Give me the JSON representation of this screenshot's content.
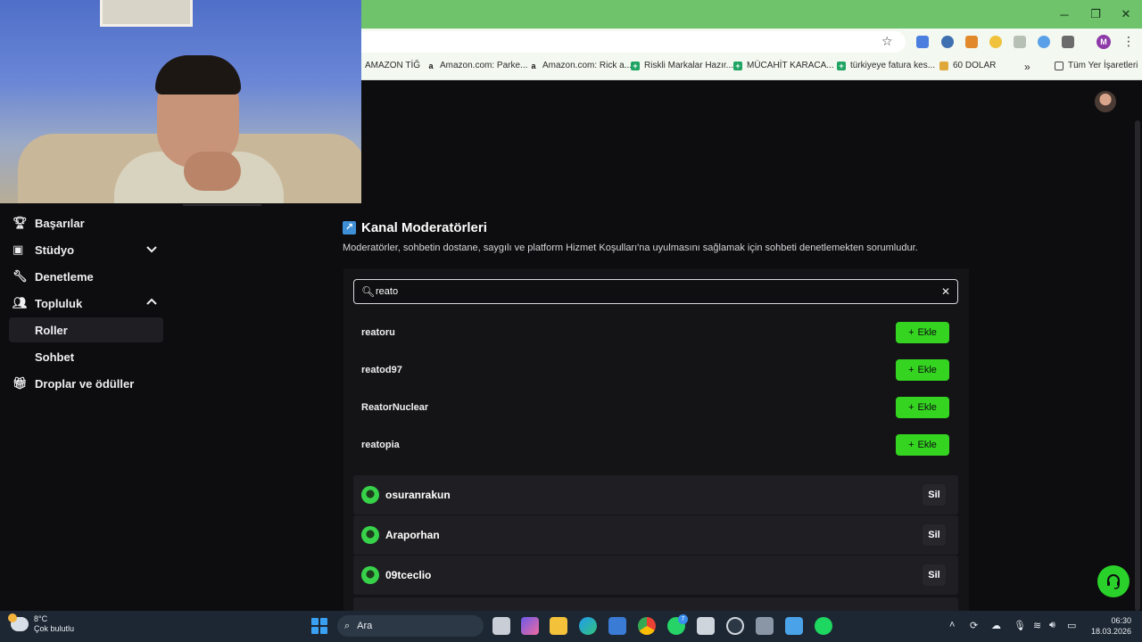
{
  "browser": {
    "window_controls": {
      "minimize": "─",
      "maximize": "❐",
      "close": "✕"
    },
    "profile_initial": "M",
    "all_bookmarks_label": "Tüm Yer İşaretleri",
    "bookmarks": [
      {
        "label": "AMAZON TİĞ"
      },
      {
        "label": "Amazon.com: Parke..."
      },
      {
        "label": "Amazon.com: Rick a..."
      },
      {
        "label": "Riskli Markalar Hazır..."
      },
      {
        "label": "MÜCAHİT KARACA..."
      },
      {
        "label": "türkiyeye fatura kes..."
      },
      {
        "label": "60 DOLAR"
      }
    ],
    "overflow_label": "»"
  },
  "sidebar": {
    "items": [
      {
        "label": "Başarılar",
        "icon": "trophy-icon"
      },
      {
        "label": "Stüdyo",
        "icon": "film-icon",
        "expanded": false
      },
      {
        "label": "Denetleme",
        "icon": "wrench-icon"
      },
      {
        "label": "Topluluk",
        "icon": "people-icon",
        "expanded": true
      },
      {
        "label": "Roller",
        "active": true
      },
      {
        "label": "Sohbet"
      },
      {
        "label": "Droplar ve ödüller",
        "icon": "gift-icon"
      }
    ]
  },
  "section": {
    "title": "Kanal Moderatörleri",
    "description": "Moderatörler, sohbetin dostane, saygılı ve platform Hizmet Koşulları'na uyulmasını sağlamak için sohbeti denetlemekten sorumludur."
  },
  "search": {
    "value": "reato",
    "clear_label": "✕"
  },
  "suggestions": [
    {
      "username": "reatoru",
      "button": "Ekle"
    },
    {
      "username": "reatod97",
      "button": "Ekle"
    },
    {
      "username": "ReatorNuclear",
      "button": "Ekle"
    },
    {
      "username": "reatopia",
      "button": "Ekle"
    }
  ],
  "moderators": [
    {
      "username": "osuranrakun",
      "button": "Sil"
    },
    {
      "username": "Araporhan",
      "button": "Sil"
    },
    {
      "username": "09tceclio",
      "button": "Sil"
    }
  ],
  "taskbar": {
    "weather_temp": "8°C",
    "weather_desc": "Çok bulutlu",
    "search_placeholder": "Ara",
    "time": "06:30",
    "date": "18.03.2026",
    "chat_badge": "7"
  },
  "colors": {
    "accent_green": "#34d421",
    "chrome_green": "#6ec36b",
    "page_bg": "#0d0d0f"
  }
}
